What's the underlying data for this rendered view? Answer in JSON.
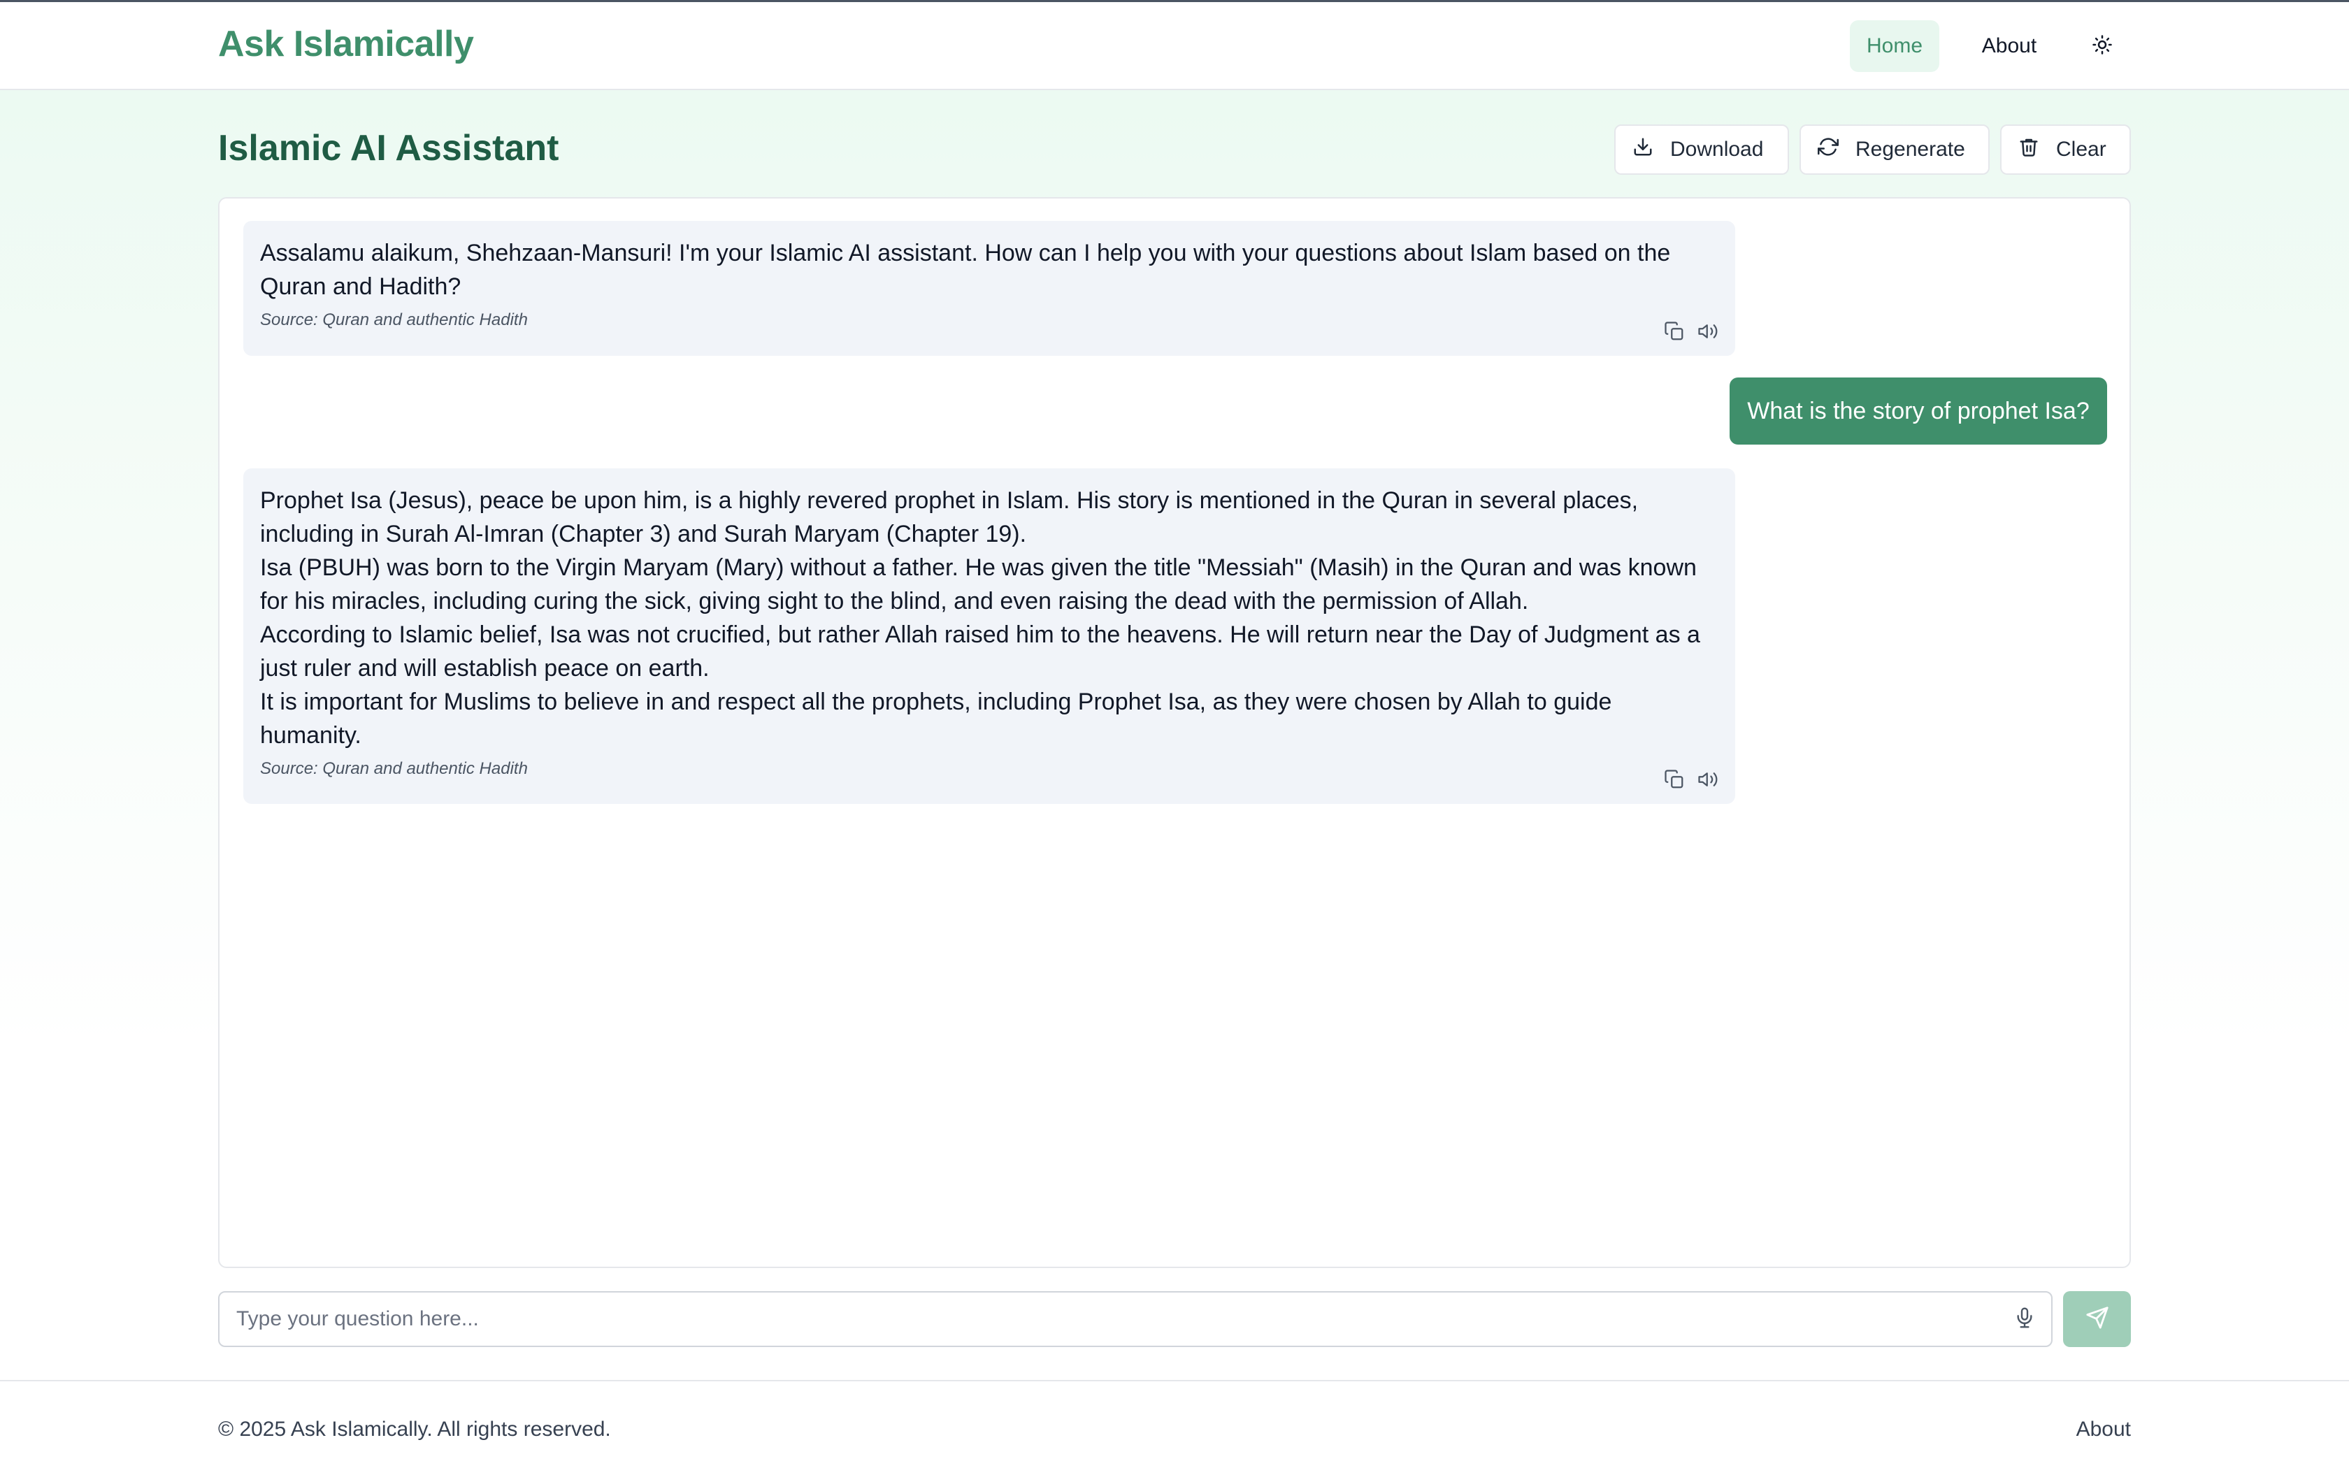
{
  "header": {
    "logo": "Ask Islamically",
    "nav": {
      "home": "Home",
      "about": "About"
    },
    "theme_icon": "sun-icon"
  },
  "page": {
    "title": "Islamic AI Assistant",
    "actions": {
      "download": "Download",
      "regenerate": "Regenerate",
      "clear": "Clear"
    }
  },
  "chat": {
    "messages": [
      {
        "role": "assistant",
        "paragraphs": [
          "Assalamu alaikum, Shehzaan-Mansuri! I'm your Islamic AI assistant. How can I help you with your questions about Islam based on the Quran and Hadith?"
        ],
        "source": "Source: Quran and authentic Hadith"
      },
      {
        "role": "user",
        "text": "What is the story of prophet Isa?"
      },
      {
        "role": "assistant",
        "paragraphs": [
          "Prophet Isa (Jesus), peace be upon him, is a highly revered prophet in Islam. His story is mentioned in the Quran in several places, including in Surah Al-Imran (Chapter 3) and Surah Maryam (Chapter 19).",
          "Isa (PBUH) was born to the Virgin Maryam (Mary) without a father. He was given the title \"Messiah\" (Masih) in the Quran and was known for his miracles, including curing the sick, giving sight to the blind, and even raising the dead with the permission of Allah.",
          "According to Islamic belief, Isa was not crucified, but rather Allah raised him to the heavens. He will return near the Day of Judgment as a just ruler and will establish peace on earth.",
          "It is important for Muslims to believe in and respect all the prophets, including Prophet Isa, as they were chosen by Allah to guide humanity."
        ],
        "source": "Source: Quran and authentic Hadith"
      }
    ]
  },
  "composer": {
    "placeholder": "Type your question here...",
    "value": ""
  },
  "footer": {
    "copyright": "© 2025 Ask Islamically. All rights reserved.",
    "about": "About"
  },
  "colors": {
    "brand": "#3f8f6b",
    "brand_dark": "#1f5c44",
    "send_disabled": "#9fceb8",
    "bot_bubble": "#f1f4f9"
  }
}
